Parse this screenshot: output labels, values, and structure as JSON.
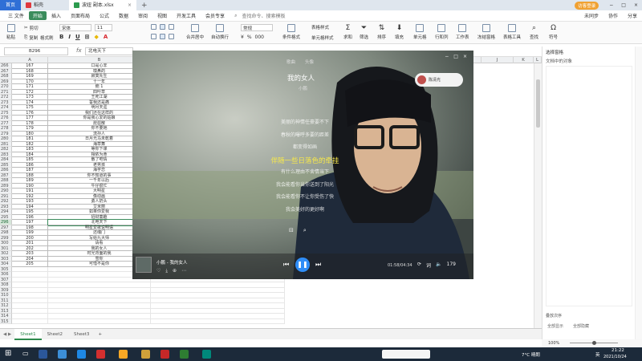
{
  "tabs": [
    {
      "label": "首页"
    },
    {
      "label": "稻壳"
    },
    {
      "label": "波妞 副本.xlsx"
    }
  ],
  "login_button": "访客登录",
  "menu": [
    "三 文件",
    "开始",
    "插入",
    "页面布局",
    "公式",
    "数据",
    "审阅",
    "视图",
    "开发工具",
    "会员专享"
  ],
  "search_placeholder": "查找命令、搜索模板",
  "menu_right": [
    "未同步",
    "协作",
    "分享"
  ],
  "ribbon": {
    "paste": "粘贴",
    "cut": "剪切",
    "copy": "复制",
    "format_painter": "格式刷",
    "font_name": "宋体",
    "font_size": "11",
    "merge_center": "合并居中",
    "wrap_text": "自动换行",
    "number_format": "常规",
    "conditional_format": "条件格式",
    "table_style": "表格样式",
    "cell_style": "单元格样式",
    "sum": "求和",
    "filter": "筛选",
    "sort": "排序",
    "fill": "填充",
    "cell": "单元格",
    "row_col": "行和列",
    "worksheet": "工作表",
    "freeze": "冻结窗格",
    "table_tools": "表格工具",
    "find": "查找",
    "symbol": "符号"
  },
  "name_box": "B296",
  "fx_label": "fx",
  "formula_value": "北电天下",
  "columns": [
    "A",
    "B",
    "C",
    "D",
    "E",
    "F",
    "G",
    "H",
    "I",
    "J",
    "K",
    "L"
  ],
  "rows": [
    {
      "rn": "266",
      "a": "167",
      "b": "口是心非"
    },
    {
      "rn": "267",
      "a": "168",
      "b": "嗅鼻的"
    },
    {
      "rn": "268",
      "a": "169",
      "b": "寂寞先生"
    },
    {
      "rn": "269",
      "a": "170",
      "b": "十一年"
    },
    {
      "rn": "270",
      "a": "171",
      "b": "鲍 1"
    },
    {
      "rn": "271",
      "a": "172",
      "b": "四叶草"
    },
    {
      "rn": "272",
      "a": "173",
      "b": "王死江湖"
    },
    {
      "rn": "273",
      "a": "174",
      "b": "誓我还是痛"
    },
    {
      "rn": "274",
      "a": "175",
      "b": "明月天涯"
    },
    {
      "rn": "275",
      "a": "176",
      "b": "我们还在这样的"
    },
    {
      "rn": "276",
      "a": "177",
      "b": "你是我心爱的姑娘"
    },
    {
      "rn": "277",
      "a": "178",
      "b": "琵琶散"
    },
    {
      "rn": "278",
      "a": "179",
      "b": "你不要她"
    },
    {
      "rn": "279",
      "a": "180",
      "b": "流孙人"
    },
    {
      "rn": "280",
      "a": "181",
      "b": "日月光马未乾着"
    },
    {
      "rn": "281",
      "a": "182",
      "b": "海草舞"
    },
    {
      "rn": "282",
      "a": "183",
      "b": "等你下课"
    },
    {
      "rn": "283",
      "a": "184",
      "b": "相依为命"
    },
    {
      "rn": "284",
      "a": "185",
      "b": "散了吧情"
    },
    {
      "rn": "285",
      "a": "186",
      "b": "老男孩"
    },
    {
      "rn": "286",
      "a": "187",
      "b": "海芋恋"
    },
    {
      "rn": "287",
      "a": "188",
      "b": "你不知道的事"
    },
    {
      "rn": "288",
      "a": "189",
      "b": "一千年以后"
    },
    {
      "rn": "289",
      "a": "190",
      "b": "牛仔很忙"
    },
    {
      "rn": "290",
      "a": "191",
      "b": "大明星"
    },
    {
      "rn": "291",
      "a": "192",
      "b": "像动画"
    },
    {
      "rn": "292",
      "a": "193",
      "b": "勇人奶头"
    },
    {
      "rn": "293",
      "a": "194",
      "b": "艾米丽"
    },
    {
      "rn": "294",
      "a": "195",
      "b": "如果你爱我"
    },
    {
      "rn": "295",
      "a": "196",
      "b": "招财童趣"
    },
    {
      "rn": "296",
      "a": "197",
      "b": "北电天下"
    },
    {
      "rn": "297",
      "a": "198",
      "b": "明星爱歌说明语"
    },
    {
      "rn": "298",
      "a": "199",
      "b": "还魂门"
    },
    {
      "rn": "299",
      "a": "200",
      "b": "写给九大师"
    },
    {
      "rn": "300",
      "a": "201",
      "b": "请看"
    },
    {
      "rn": "301",
      "a": "202",
      "b": "我的女人"
    },
    {
      "rn": "302",
      "a": "203",
      "b": "时光背面的我"
    },
    {
      "rn": "303",
      "a": "204",
      "b": "雪你"
    },
    {
      "rn": "304",
      "a": "205",
      "b": "可惜不是你"
    },
    {
      "rn": "305",
      "a": "",
      "b": ""
    },
    {
      "rn": "306",
      "a": "",
      "b": ""
    },
    {
      "rn": "307",
      "a": "",
      "b": ""
    },
    {
      "rn": "308",
      "a": "",
      "b": ""
    },
    {
      "rn": "309",
      "a": "",
      "b": ""
    },
    {
      "rn": "310",
      "a": "",
      "b": ""
    },
    {
      "rn": "311",
      "a": "",
      "b": ""
    },
    {
      "rn": "312",
      "a": "",
      "b": ""
    },
    {
      "rn": "313",
      "a": "",
      "b": ""
    },
    {
      "rn": "314",
      "a": "",
      "b": ""
    },
    {
      "rn": "315",
      "a": "",
      "b": ""
    }
  ],
  "sheets": [
    "Sheet1",
    "Sheet2",
    "Sheet3"
  ],
  "side_panel": {
    "title": "选择窗格",
    "subtitle": "文档中的对象",
    "order_label": "叠放次序",
    "show_all": "全部显示",
    "hide_all": "全部隐藏"
  },
  "player": {
    "tabs": [
      "歌曲",
      "头像"
    ],
    "song_title": "我的女人",
    "artist": "小鹏",
    "user_name": "陈清光",
    "lyrics": [
      "美丽的神情任豪要不下",
      "春秋的曝呼多要的距差",
      "都变得如画",
      "伴随一些日落色的牵挂",
      "有什么理由不舍情当下",
      "我会能看你当你送到了阳光",
      "我会能看你不让你受伤了快",
      "我会美好的更好啊"
    ],
    "current_lyric_index": 3,
    "now_playing": "小鹏 - 我的女人",
    "time": "01:58/04:34",
    "count": "179"
  },
  "status": {
    "zoom": "100%"
  },
  "taskbar": {
    "weather": "7°C 晴朗",
    "lang": "英",
    "time": "21:22",
    "date": "2021/10/24"
  }
}
